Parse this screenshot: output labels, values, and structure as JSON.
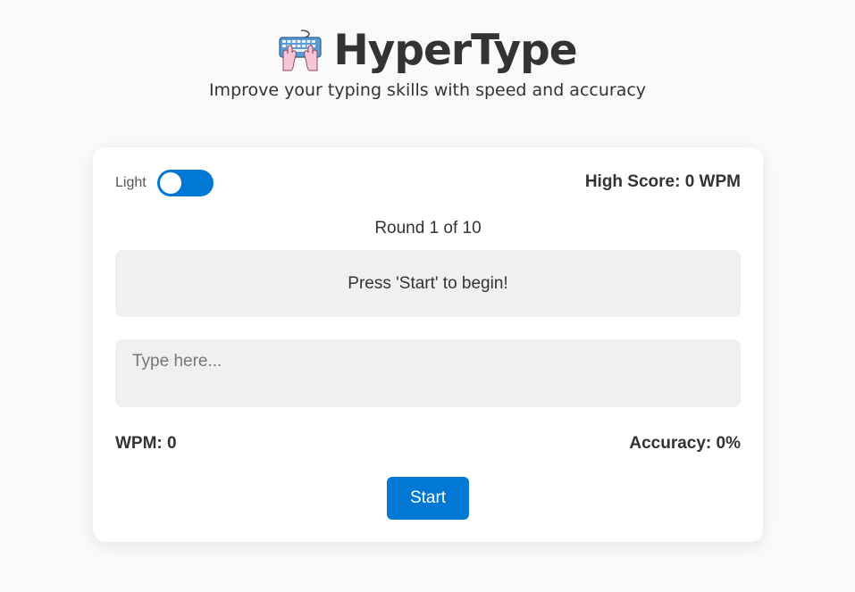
{
  "header": {
    "logo_icon": "keyboard-with-hands-icon",
    "title": "HyperType",
    "tagline": "Improve your typing skills with speed and accuracy"
  },
  "game": {
    "theme_label": "Light",
    "theme_toggle_on": true,
    "high_score": "High Score: 0 WPM",
    "round": "Round 1 of 10",
    "prompt": "Press 'Start' to begin!",
    "input": {
      "value": "",
      "placeholder": "Type here..."
    },
    "wpm": "WPM: 0",
    "accuracy": "Accuracy: 0%",
    "start_label": "Start"
  },
  "colors": {
    "accent": "#0078d4",
    "background": "#fafafa",
    "card": "#ffffff",
    "panel": "#f0f0f0",
    "text": "#333333"
  }
}
